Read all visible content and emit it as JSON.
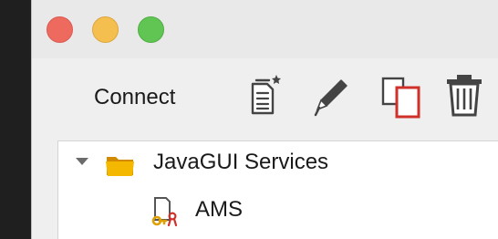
{
  "window": {
    "controls": {
      "close_color": "#ee6a5f",
      "minimize_color": "#f5bf4f",
      "zoom_color": "#61c554"
    }
  },
  "toolbar": {
    "connect_label": "Connect",
    "icons": [
      "new-document-icon",
      "edit-pencil-icon",
      "duplicate-icon",
      "trash-icon"
    ]
  },
  "tree": {
    "root": {
      "label": "JavaGUI Services",
      "expanded": true,
      "icon": "folder-icon"
    },
    "children": [
      {
        "label": "AMS",
        "icon": "service-key-icon"
      }
    ]
  }
}
